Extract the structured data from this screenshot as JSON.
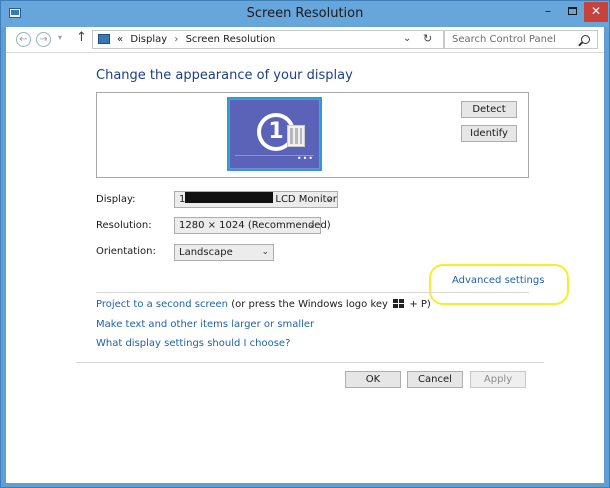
{
  "window": {
    "title": "Screen Resolution",
    "controls": {
      "minimize": "–",
      "close": "✕"
    }
  },
  "nav": {
    "back_glyph": "←",
    "forward_glyph": "→",
    "recent_glyph": "▾",
    "up_glyph": "↑",
    "breadcrumb": [
      "Display",
      "Screen Resolution"
    ],
    "breadcrumb_prefix": "«",
    "separator": "›",
    "dropdown_glyph": "⌄",
    "refresh_glyph": "↻",
    "search_placeholder": "Search Control Panel"
  },
  "main": {
    "heading": "Change the appearance of your display",
    "monitor_number": "1",
    "monitor_dots": "•••",
    "detect_label": "Detect",
    "identify_label": "Identify",
    "fields": {
      "display_label": "Display:",
      "display_prefix": "1",
      "display_value": "LCD Monitor",
      "resolution_label": "Resolution:",
      "resolution_value": "1280 × 1024 (Recommended)",
      "orientation_label": "Orientation:",
      "orientation_value": "Landscape"
    },
    "advanced_settings": "Advanced settings",
    "project_link": "Project to a second screen",
    "project_note_before": "(or press the Windows logo key",
    "project_note_after": "+ P)",
    "text_size_link": "Make text and other items larger or smaller",
    "choose_link": "What display settings should I choose?"
  },
  "buttons": {
    "ok": "OK",
    "cancel": "Cancel",
    "apply": "Apply"
  },
  "colors": {
    "frame": "#5f9fd4",
    "heading": "#1e3e87",
    "link": "#1e62a8",
    "highlight": "#f5ef2b",
    "monitor": "#5a63b8"
  }
}
